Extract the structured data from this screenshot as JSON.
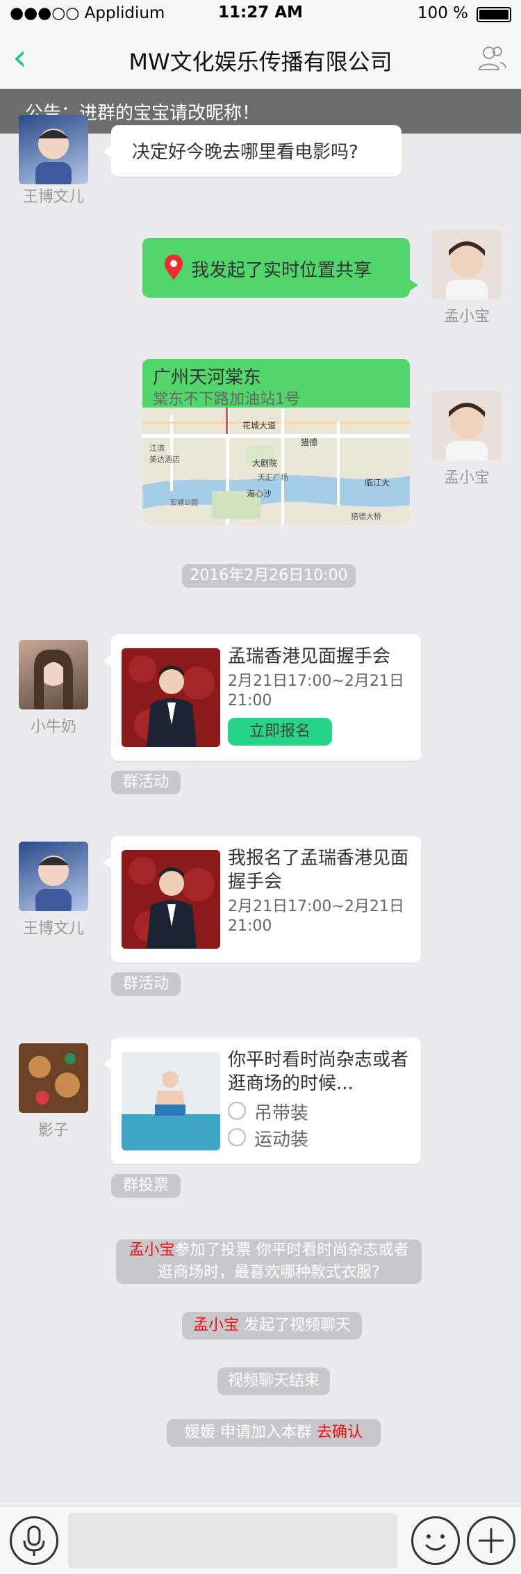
{
  "status": {
    "carrier": "●●●○○ Applidium",
    "time": "11:27 AM",
    "battery": "100 %"
  },
  "nav": {
    "title": "MW文化娱乐传播有限公司"
  },
  "notice": {
    "text": "公告：进群的宝宝请改昵称！"
  },
  "msg1": {
    "name": "王博文儿",
    "text": "决定好今晚去哪里看电影吗?"
  },
  "msg2": {
    "text": "我发起了实时位置共享",
    "name": "孟小宝"
  },
  "msg3": {
    "title": "广州天河棠东",
    "address": "棠东不下路加油站1号",
    "name": "孟小宝",
    "map_labels": [
      "花城大道",
      "猎德",
      "大剧院",
      "天汇广场",
      "海心沙",
      "江滨",
      "美达酒店",
      "宏城公园",
      "临江大",
      "猎德大桥"
    ]
  },
  "time1": "2016年2月26日10:00",
  "msg4": {
    "name": "小牛奶",
    "title": "孟瑞香港见面握手会",
    "time": "2月21日17:00~2月21日21:00",
    "button": "立即报名",
    "tag": "群活动"
  },
  "msg5": {
    "name": "王博文儿",
    "title": "我报名了孟瑞香港见面握手会",
    "time": "2月21日17:00~2月21日21:00",
    "tag": "群活动"
  },
  "msg6": {
    "name": "影子",
    "title": "你平时看时尚杂志或者逛商场的时候...",
    "options": [
      "吊带装",
      "运动装"
    ],
    "tag": "群投票"
  },
  "sys1": {
    "who": "孟小宝",
    "text": "参加了投票 你平时看时尚杂志或者逛商场时，最喜欢哪种款式衣服?"
  },
  "sys2": {
    "who": "孟小宝",
    "text": " 发起了视频聊天"
  },
  "sys3": {
    "text": "视频聊天结束"
  },
  "sys4": {
    "who": "媛媛",
    "text": " 申请加入本群  ",
    "action": "去确认"
  },
  "colors": {
    "accent": "#22c67a",
    "green_bubble": "#52d56b",
    "highlight": "#ED0D0D",
    "input_bg": "#E5E5E5"
  }
}
